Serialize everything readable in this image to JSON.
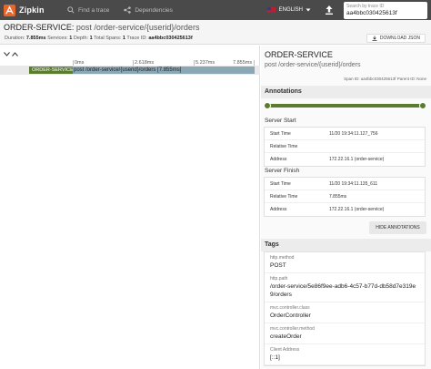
{
  "topbar": {
    "logo_text": "Zipkin",
    "nav": [
      {
        "label": "Find a trace",
        "icon": "search-icon"
      },
      {
        "label": "Dependencies",
        "icon": "dependencies-icon"
      }
    ],
    "language": "ENGLISH",
    "search_placeholder": "Search by trace ID",
    "search_value": "aa4bbc030425613f"
  },
  "header": {
    "service": "ORDER-SERVICE",
    "span_name": "post /order-service/{userid}/orders",
    "duration_label": "Duration:",
    "duration": "7.855ms",
    "services_label": "Services:",
    "services": "1",
    "depth_label": "Depth:",
    "depth": "1",
    "total_spans_label": "Total Spans:",
    "total_spans": "1",
    "trace_id_label": "Trace ID:",
    "trace_id": "aa4bbc030425613f",
    "download_label": "DOWNLOAD JSON"
  },
  "timeline": {
    "ticks": [
      "0ms",
      "2.618ms",
      "5.237ms",
      "7.855ms"
    ],
    "span": {
      "service": "ORDER-SERVICE",
      "label": "post /order-service/{userid}/orders [7.855ms]"
    }
  },
  "detail": {
    "service": "ORDER-SERVICE",
    "span_name": "post /order-service/{userid}/orders",
    "span_id_label": "Span ID:",
    "span_id": "aa4bbc030425613f",
    "parent_id_label": "Parent ID:",
    "parent_id": "None",
    "annotations_title": "Annotations",
    "server_start": {
      "title": "Server Start",
      "rows": [
        {
          "key": "Start Time",
          "value": "11/20 19:34:11.127_756"
        },
        {
          "key": "Relative Time",
          "value": ""
        },
        {
          "key": "Address",
          "value": "172.22.16.1 (order-service)"
        }
      ]
    },
    "server_finish": {
      "title": "Server Finish",
      "rows": [
        {
          "key": "Start Time",
          "value": "11/20 19:34:11.135_611"
        },
        {
          "key": "Relative Time",
          "value": "7.855ms"
        },
        {
          "key": "Address",
          "value": "172.22.16.1 (order-service)"
        }
      ]
    },
    "hide_label": "HIDE ANNOTATIONS",
    "tags_title": "Tags",
    "tags": [
      {
        "key": "http.method",
        "value": "POST"
      },
      {
        "key": "http.path",
        "value": "/order-service/5e86f9ee-adb6-4c57-b77d-db58d7e319e9/orders"
      },
      {
        "key": "mvc.controller.class",
        "value": "OrderController"
      },
      {
        "key": "mvc.controller.method",
        "value": "createOrder"
      },
      {
        "key": "Client Address",
        "value": "[::1]"
      }
    ]
  },
  "colors": {
    "topbar": "#4a4a4a",
    "service_badge": "#5a7c2f",
    "span_bar": "#8ba7b5",
    "logo_orange": "#e8662b"
  }
}
